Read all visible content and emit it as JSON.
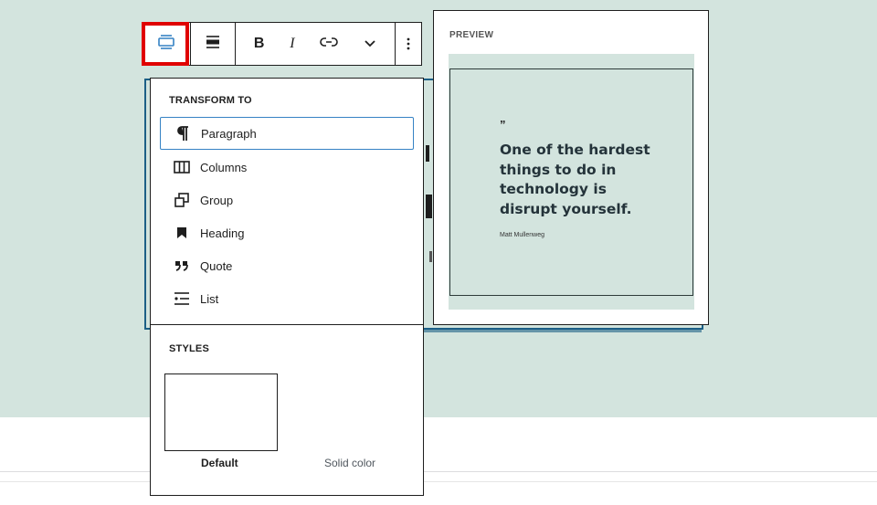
{
  "toolbar": {
    "transform_icon": "quote-transform-icon",
    "align_icon": "align-icon",
    "bold_label": "B",
    "italic_label": "I",
    "link_icon": "link-icon",
    "more_formatting_icon": "chevron-down-icon",
    "options_icon": "more-vertical-icon",
    "highlight_color": "#e00000"
  },
  "menu": {
    "transform_title": "TRANSFORM TO",
    "items": [
      {
        "label": "Paragraph",
        "icon": "paragraph-icon"
      },
      {
        "label": "Columns",
        "icon": "columns-icon"
      },
      {
        "label": "Group",
        "icon": "group-icon"
      },
      {
        "label": "Heading",
        "icon": "heading-icon"
      },
      {
        "label": "Quote",
        "icon": "quote-icon"
      },
      {
        "label": "List",
        "icon": "list-icon"
      }
    ],
    "styles_title": "STYLES",
    "style_options": [
      {
        "label": "Default",
        "selected": true
      },
      {
        "label": "Solid color",
        "selected": false
      }
    ]
  },
  "preview": {
    "title": "PREVIEW",
    "quote_mark": "”",
    "quote_text": "One of the hardest things to do in technology is disrupt yourself.",
    "citation": "Matt Mullenweg"
  },
  "colors": {
    "canvas": "#d3e4de",
    "focus_border": "#3582c4",
    "block_border": "#1c5f86"
  }
}
